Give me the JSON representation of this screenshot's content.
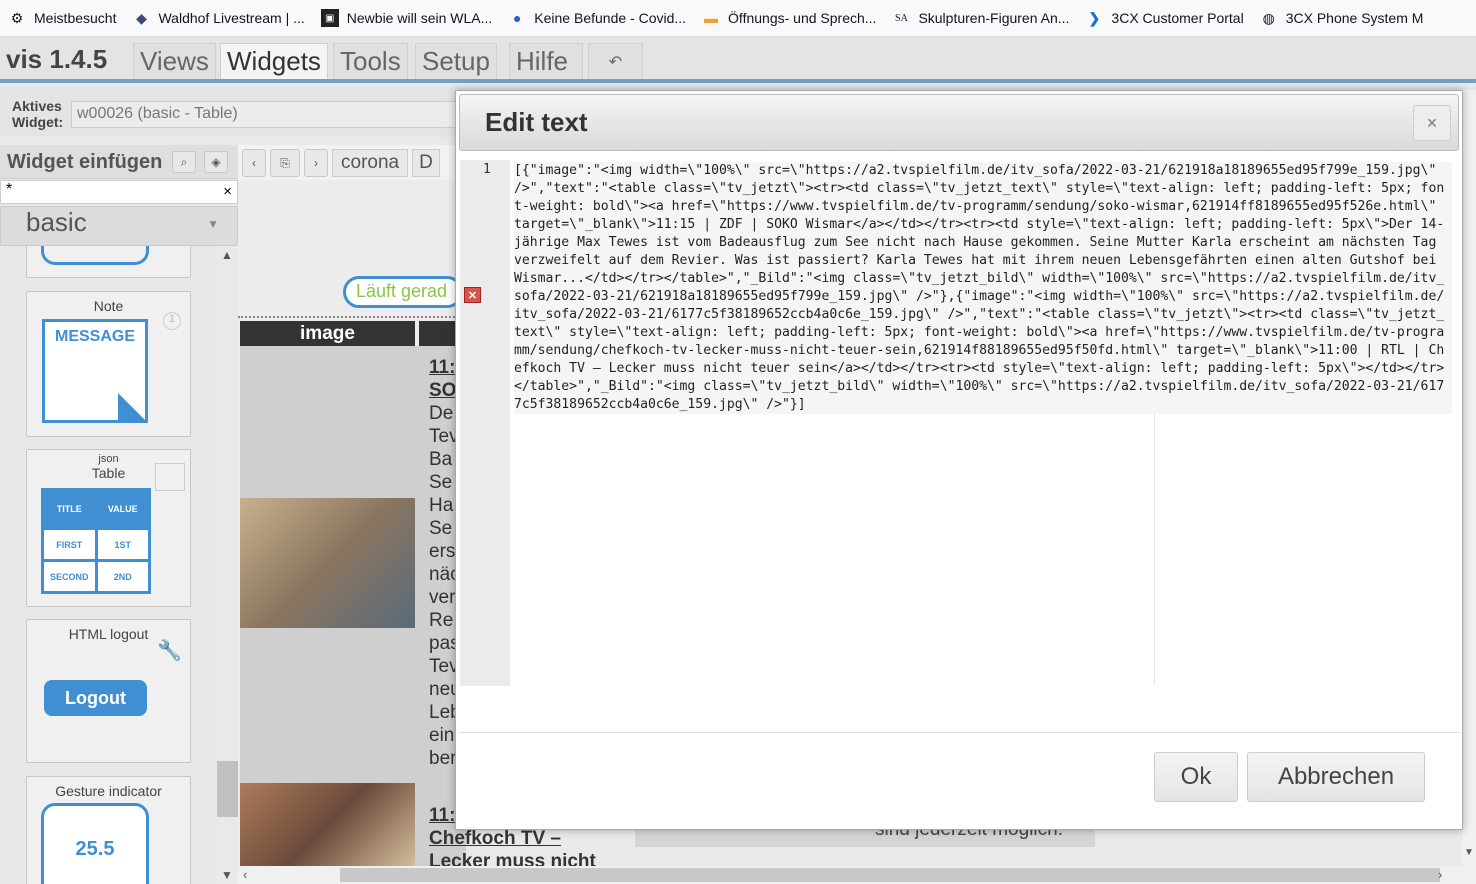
{
  "bookmarks": [
    {
      "icon": "gear-icon",
      "label": "Meistbesucht"
    },
    {
      "icon": "diamond-icon",
      "label": "Waldhof Livestream | ..."
    },
    {
      "icon": "tv-icon",
      "label": "Newbie will sein WLA..."
    },
    {
      "icon": "person-icon",
      "label": "Keine Befunde - Covid..."
    },
    {
      "icon": "flag-icon",
      "label": "Öffnungs- und Sprech..."
    },
    {
      "icon": "sa-icon",
      "label": "Skulpturen-Figuren An..."
    },
    {
      "icon": "chevron-icon",
      "label": "3CX Customer Portal"
    },
    {
      "icon": "globe-icon",
      "label": "3CX Phone System M"
    }
  ],
  "app": {
    "title": "vis 1.4.5",
    "menus": [
      "Views",
      "Widgets",
      "Tools",
      "Setup",
      "Hilfe"
    ],
    "undo_icon": "undo-icon"
  },
  "active_widget": {
    "label": "Aktives Widget:",
    "value": "w00026 (basic - Table)"
  },
  "widget_insert": {
    "title": "Widget einfügen",
    "filter": "*",
    "set": "basic"
  },
  "toolbar": {
    "view_tab": "corona",
    "view_tab2": "D"
  },
  "canvas": {
    "status_label": "Läuft gerad",
    "column_header": "image",
    "row_text": [
      "11:",
      "SO",
      "De",
      "Tev",
      "Ba",
      "Se",
      "Ha",
      "Se",
      "ers",
      "näc",
      "ver",
      "Re",
      "pas",
      "Tev",
      "neu",
      "Leb",
      "ein",
      "ber"
    ],
    "row2_title": "11:",
    "row2_link": "Chefkoch TV –",
    "row2_link2": "Lecker muss nicht",
    "foot_text": "sind jederzeit möglich."
  },
  "palette": [
    {
      "name": "Note",
      "icon_text": "MESSAGE"
    },
    {
      "name": "Table",
      "sub": "json",
      "cells": [
        "TITLE",
        "VALUE",
        "FIRST",
        "1ST",
        "SECOND",
        "2ND"
      ]
    },
    {
      "name": "HTML logout",
      "button": "Logout"
    },
    {
      "name": "Gesture indicator",
      "value": "25.5"
    }
  ],
  "dialog": {
    "title": "Edit text",
    "line_number": "1",
    "code": "[{\"image\":\"<img width=\\\"100%\\\" src=\\\"https://a2.tvspielfilm.de/itv_sofa/2022-03-21/621918a18189655ed95f799e_159.jpg\\\" />\",\"text\":\"<table class=\\\"tv_jetzt\\\"><tr><td class=\\\"tv_jetzt_text\\\" style=\\\"text-align: left; padding-left: 5px; font-weight: bold\\\"><a href=\\\"https://www.tvspielfilm.de/tv-programm/sendung/soko-wismar,621914ff8189655ed95f526e.html\\\" target=\\\"_blank\\\">11:15 | ZDF | SOKO Wismar</a></td></tr><tr><td style=\\\"text-align: left; padding-left: 5px\\\">Der 14-jährige Max Tewes ist vom Badeausflug zum See nicht nach Hause gekommen. Seine Mutter Karla erscheint am nächsten Tag verzweifelt auf dem Revier. Was ist passiert? Karla Tewes hat mit ihrem neuen Lebensgefährten einen alten Gutshof bei Wismar...</td></tr></table>\",\"_Bild\":\"<img class=\\\"tv_jetzt_bild\\\" width=\\\"100%\\\" src=\\\"https://a2.tvspielfilm.de/itv_sofa/2022-03-21/621918a18189655ed95f799e_159.jpg\\\" />\"},{\"image\":\"<img width=\\\"100%\\\" src=\\\"https://a2.tvspielfilm.de/itv_sofa/2022-03-21/6177c5f38189652ccb4a0c6e_159.jpg\\\" />\",\"text\":\"<table class=\\\"tv_jetzt\\\"><tr><td class=\\\"tv_jetzt_text\\\" style=\\\"text-align: left; padding-left: 5px; font-weight: bold\\\"><a href=\\\"https://www.tvspielfilm.de/tv-programm/sendung/chefkoch-tv-lecker-muss-nicht-teuer-sein,621914f88189655ed95f50fd.html\\\" target=\\\"_blank\\\">11:00 | RTL | Chefkoch TV – Lecker muss nicht teuer sein</a></td></tr><tr><td style=\\\"text-align: left; padding-left: 5px\\\"></td></tr></table>\",\"_Bild\":\"<img class=\\\"tv_jetzt_bild\\\" width=\\\"100%\\\" src=\\\"https://a2.tvspielfilm.de/itv_sofa/2022-03-21/6177c5f38189652ccb4a0c6e_159.jpg\\\" />\"}]",
    "ok": "Ok",
    "cancel": "Abbrechen",
    "close": "×"
  }
}
